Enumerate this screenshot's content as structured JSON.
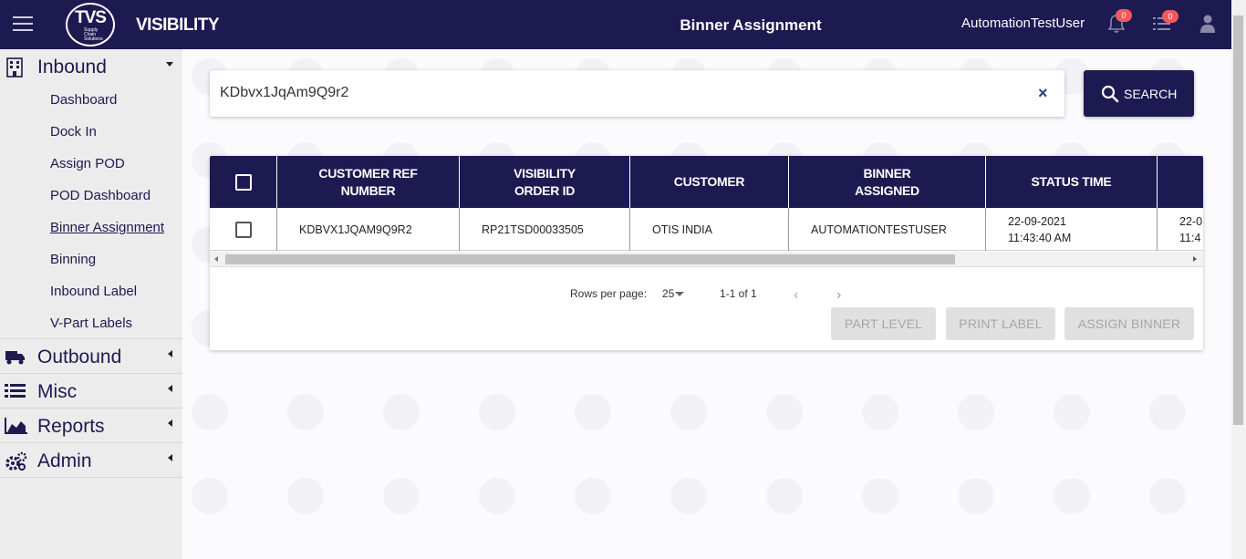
{
  "header": {
    "logo_text": "TVS",
    "logo_sub": "Supply Chain Solutions",
    "app_name": "VISIBILITY",
    "page_title": "Binner Assignment",
    "username": "AutomationTestUser",
    "notifications_count": "0",
    "tasks_count": "0"
  },
  "sidebar": {
    "inbound": {
      "label": "Inbound",
      "items": [
        {
          "label": "Dashboard"
        },
        {
          "label": "Dock In"
        },
        {
          "label": "Assign POD"
        },
        {
          "label": "POD Dashboard"
        },
        {
          "label": "Binner Assignment"
        },
        {
          "label": "Binning"
        },
        {
          "label": "Inbound Label"
        },
        {
          "label": "V-Part Labels"
        }
      ]
    },
    "outbound": {
      "label": "Outbound"
    },
    "misc": {
      "label": "Misc"
    },
    "reports": {
      "label": "Reports"
    },
    "admin": {
      "label": "Admin"
    }
  },
  "search": {
    "value": "KDbvx1JqAm9Q9r2",
    "clear_icon": "×",
    "button_label": "SEARCH"
  },
  "table": {
    "columns": [
      "CUSTOMER REF NUMBER",
      "VISIBILITY ORDER ID",
      "CUSTOMER",
      "BINNER ASSIGNED",
      "STATUS TIME"
    ],
    "col1a": "CUSTOMER REF",
    "col1b": "NUMBER",
    "col2a": "VISIBILITY",
    "col2b": "ORDER ID",
    "col3": "CUSTOMER",
    "col4a": "BINNER",
    "col4b": "ASSIGNED",
    "col5": "STATUS TIME",
    "rows": [
      {
        "customer_ref": "KDBVX1JQAM9Q9R2",
        "order_id": "RP21TSD00033505",
        "customer": "OTIS INDIA",
        "binner": "AUTOMATIONTESTUSER",
        "status_date": "22-09-2021",
        "status_time": "11:43:40 AM",
        "extra_date": "22-0",
        "extra_time": "11:4"
      }
    ]
  },
  "pagination": {
    "rows_per_page_label": "Rows per page:",
    "rows_per_page": "25",
    "range": "1-1 of 1",
    "prev": "‹",
    "next": "›"
  },
  "actions": {
    "part_level": "PART LEVEL",
    "print_label": "PRINT LABEL",
    "assign_binner": "ASSIGN BINNER"
  },
  "colors": {
    "primary": "#1d1a52",
    "badge": "#f05a5a"
  }
}
